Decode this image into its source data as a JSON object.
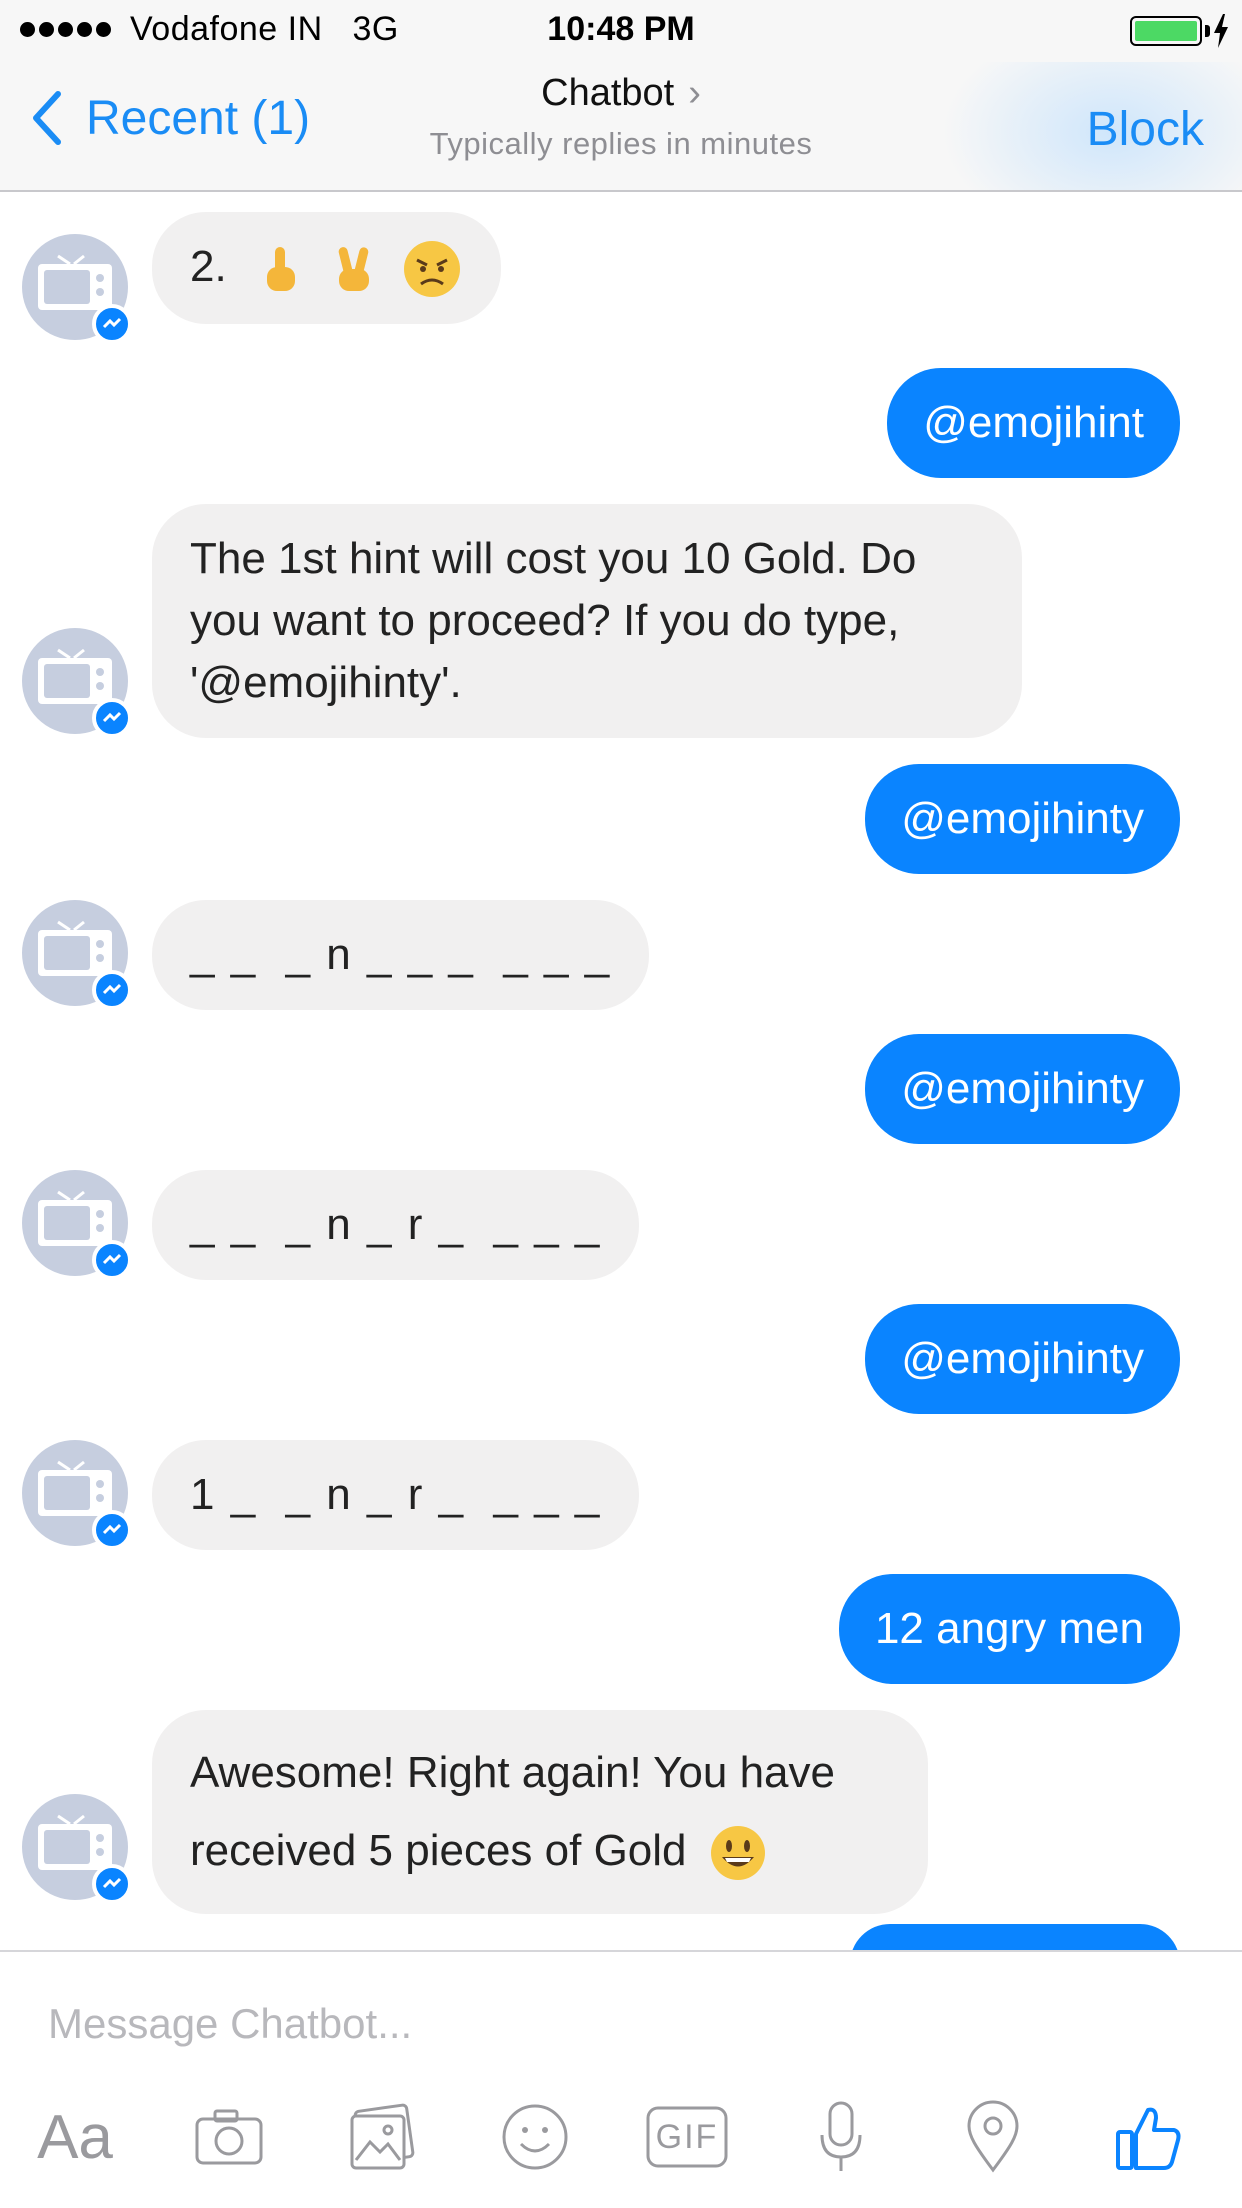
{
  "status_bar": {
    "carrier": "Vodafone IN",
    "network": "3G",
    "time": "10:48 PM",
    "battery_level": 1.0
  },
  "nav": {
    "back_label": "Recent (1)",
    "title": "Chatbot",
    "subtitle": "Typically replies in minutes",
    "block_label": "Block"
  },
  "messages": [
    {
      "from": "bot",
      "text": "2."
    },
    {
      "from": "me",
      "text": "@emojihint"
    },
    {
      "from": "bot",
      "text": "The 1st hint will cost you 10 Gold. Do you want to proceed? If you do type, '@emojihinty'."
    },
    {
      "from": "me",
      "text": "@emojihinty"
    },
    {
      "from": "bot",
      "text": "_ _  _ n _ _ _  _ _ _"
    },
    {
      "from": "me",
      "text": "@emojihinty"
    },
    {
      "from": "bot",
      "text": "_ _  _ n _ r _  _ _ _"
    },
    {
      "from": "me",
      "text": "@emojihinty"
    },
    {
      "from": "bot",
      "text": "1 _  _ n _ r _  _ _ _"
    },
    {
      "from": "me",
      "text": "12 angry men"
    },
    {
      "from": "bot",
      "text": "Awesome! Right again! You have received 5 pieces of Gold"
    }
  ],
  "composer": {
    "placeholder": "Message Chatbot...",
    "tools": [
      "text-format-icon",
      "camera-icon",
      "photo-icon",
      "emoji-icon",
      "gif-icon",
      "microphone-icon",
      "location-icon",
      "thumbs-up-icon"
    ],
    "aa_label": "Aa",
    "gif_label": "GIF"
  },
  "colors": {
    "accent": "#0a84ff",
    "incoming_bubble": "#f1f0f0",
    "nav_bg": "#f7f7f7"
  }
}
